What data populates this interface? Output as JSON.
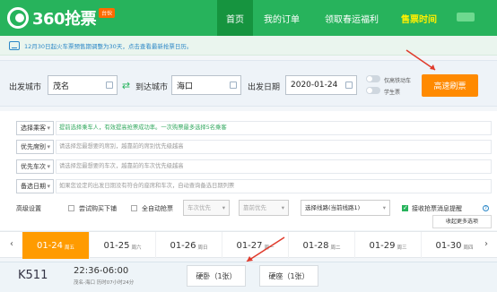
{
  "header": {
    "logo_text": "360抢票",
    "logo_badge": "台伙",
    "nav_items": [
      {
        "label": "首页",
        "active": true
      },
      {
        "label": "我的订单",
        "active": false
      },
      {
        "label": "领取春运福利",
        "active": false
      },
      {
        "label": "售票时间",
        "active": false
      }
    ],
    "accent_color": "#27b35c"
  },
  "notice": {
    "text": "12月30日起火车票预售期调整为30天，点击查看最新抢票日历。"
  },
  "search": {
    "from_label": "出发城市",
    "from_value": "茂名",
    "to_label": "到达城市",
    "to_value": "海口",
    "date_label": "出发日期",
    "date_value": "2020-01-24",
    "toggle_highspeed": "仅高铁动车",
    "toggle_student": "学生票",
    "search_button": "高速刷票"
  },
  "filters": [
    {
      "select": "选择乘客",
      "text": "提前选择乘车人，有效提高抢票成功率。一次购票最多选择5名乘客",
      "style": "green"
    },
    {
      "select": "优先席别",
      "text": "请选择您最想要的席别，越靠前的席别优先级越高",
      "style": "gray"
    },
    {
      "select": "优先车次",
      "text": "请选择您最想要的车次，越靠前的车次优先级越高",
      "style": "gray"
    },
    {
      "select": "备选日期",
      "text": "如果您设定的出发日期没有符合的座席和车次，自动查询备选日期列票",
      "style": "gray"
    }
  ],
  "advanced": {
    "title": "高级设置",
    "partial_submit": "尝试购买下铺",
    "auto_grab": "全自动抢票",
    "train_priority": "车次优先",
    "seat_priority": "靠前优先",
    "route_select": "选择线路(当前线路1)",
    "notify": "接收抢票消息提醒",
    "help": "?",
    "collapse": "收起更多选项"
  },
  "dates": [
    {
      "date": "01-24",
      "weekday": "周五",
      "selected": true
    },
    {
      "date": "01-25",
      "weekday": "周六",
      "selected": false
    },
    {
      "date": "01-26",
      "weekday": "周日",
      "selected": false
    },
    {
      "date": "01-27",
      "weekday": "周一",
      "selected": false
    },
    {
      "date": "01-28",
      "weekday": "周二",
      "selected": false
    },
    {
      "date": "01-29",
      "weekday": "周三",
      "selected": false
    },
    {
      "date": "01-30",
      "weekday": "周四",
      "selected": false
    }
  ],
  "ticket": {
    "train_no": "K511",
    "time": "22:36-06:00",
    "route": "茂名-海口 历时07小时24分",
    "seat_1": "硬卧（1张）",
    "seat_2": "硬座（1张）"
  }
}
